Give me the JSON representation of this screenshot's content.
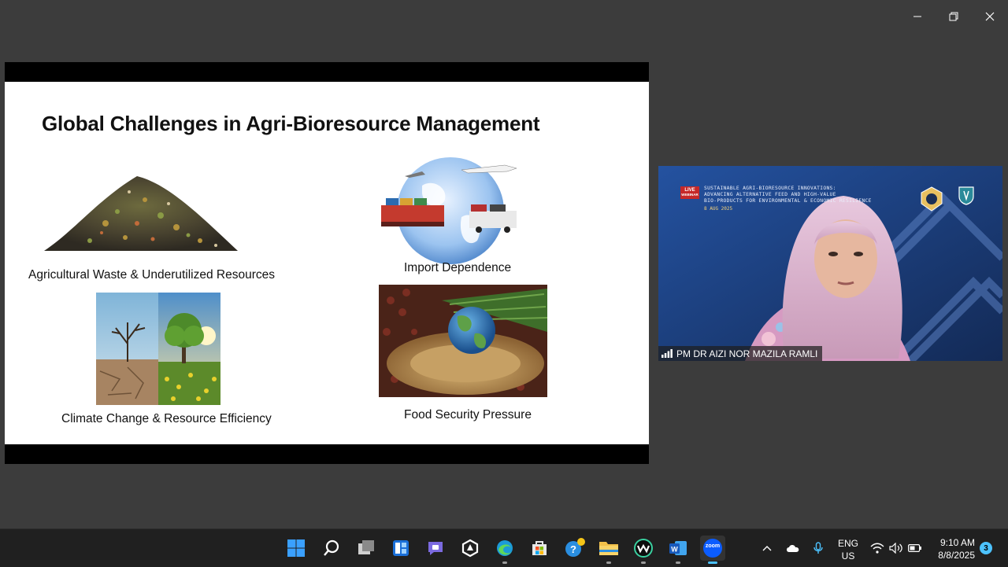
{
  "window": {
    "controls": [
      "minimize",
      "restore",
      "close"
    ]
  },
  "slide": {
    "title": "Global Challenges in Agri-Bioresource Management",
    "items": [
      {
        "caption": "Agricultural Waste & Underutilized Resources",
        "icon": "waste-heap-image"
      },
      {
        "caption": "Import Dependence",
        "icon": "globe-trade-image"
      },
      {
        "caption": "Climate Change & Resource Efficiency",
        "icon": "climate-tree-image"
      },
      {
        "caption": "Food Security Pressure",
        "icon": "grain-globe-image"
      }
    ]
  },
  "video": {
    "live_badge": "LIVE",
    "webinar_label": "WEBINAR",
    "banner_line1": "SUSTAINABLE AGRI-BIORESOURCE INNOVATIONS:",
    "banner_line2": "ADVANCING ALTERNATIVE FEED AND HIGH-VALUE",
    "banner_line3": "BIO-PRODUCTS FOR ENVIRONMENTAL & ECONOMIC RESILIENCE",
    "banner_date": "8 AUG 2025",
    "participant_name": "PM DR AIZI NOR MAZILA RAMLI"
  },
  "taskbar": {
    "apps": [
      "start",
      "search",
      "task-view",
      "widgets",
      "teams-chat",
      "copilot",
      "edge",
      "store",
      "get-help",
      "file-explorer",
      "webex",
      "word",
      "zoom"
    ],
    "zoom_label": "zoom",
    "language": "ENG",
    "region": "US",
    "time": "9:10 AM",
    "date": "8/8/2025",
    "notification_count": "3"
  },
  "colors": {
    "desktop": "#3c3c3c",
    "taskbar": "#202020",
    "accent": "#4cc2ff",
    "video_bg": "#1d3d78"
  }
}
